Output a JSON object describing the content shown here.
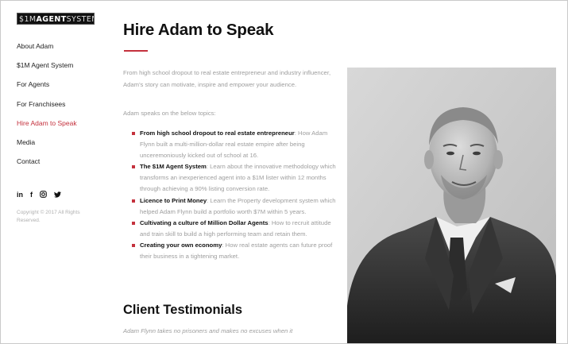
{
  "logo": {
    "prefix": "$1M",
    "main": "AGENT",
    "suffix": "SYSTEM"
  },
  "nav": {
    "items": [
      {
        "label": "About Adam"
      },
      {
        "label": "$1M Agent System"
      },
      {
        "label": "For Agents"
      },
      {
        "label": "For Franchisees"
      },
      {
        "label": "Hire Adam to Speak",
        "active": true
      },
      {
        "label": "Media"
      },
      {
        "label": "Contact"
      }
    ]
  },
  "social": {
    "linkedin": "in",
    "facebook": "f",
    "instagram": "◎",
    "twitter": "🐦"
  },
  "copyright": "Copyright © 2017 All Rights Reserved.",
  "main": {
    "title": "Hire Adam to Speak",
    "intro": "From high school dropout to real estate entrepreneur and industry influencer, Adam's story can motivate, inspire and empower your audience.",
    "topics_lead": "Adam speaks on the below topics:",
    "topics": [
      {
        "heading": "From high school dropout to real estate entrepreneur",
        "text": ": How Adam Flynn built a multi-million-dollar real estate empire after being unceremoniously kicked out of school at 16."
      },
      {
        "heading": "The $1M Agent System",
        "text": ": Learn about the innovative methodology which transforms an inexperienced agent into a $1M lister within 12 months through achieving a 90% listing conversion rate."
      },
      {
        "heading": "Licence to Print Money",
        "text": ": Learn the Property development system which helped Adam Flynn build a portfolio worth $7M within 5 years."
      },
      {
        "heading": "Cultivating a culture of Million Dollar Agents",
        "text": ": How to recruit attitude and train skill to build a high performing team and retain them."
      },
      {
        "heading": "Creating your own economy",
        "text": ": How real estate agents can future proof their business in a tightening market."
      }
    ],
    "testimonials_heading": "Client Testimonials",
    "testimonial_quote": "Adam Flynn takes no prisoners and makes no excuses when it"
  },
  "colors": {
    "accent": "#c4313d",
    "text": "#111111",
    "muted": "#9e9e9e"
  }
}
